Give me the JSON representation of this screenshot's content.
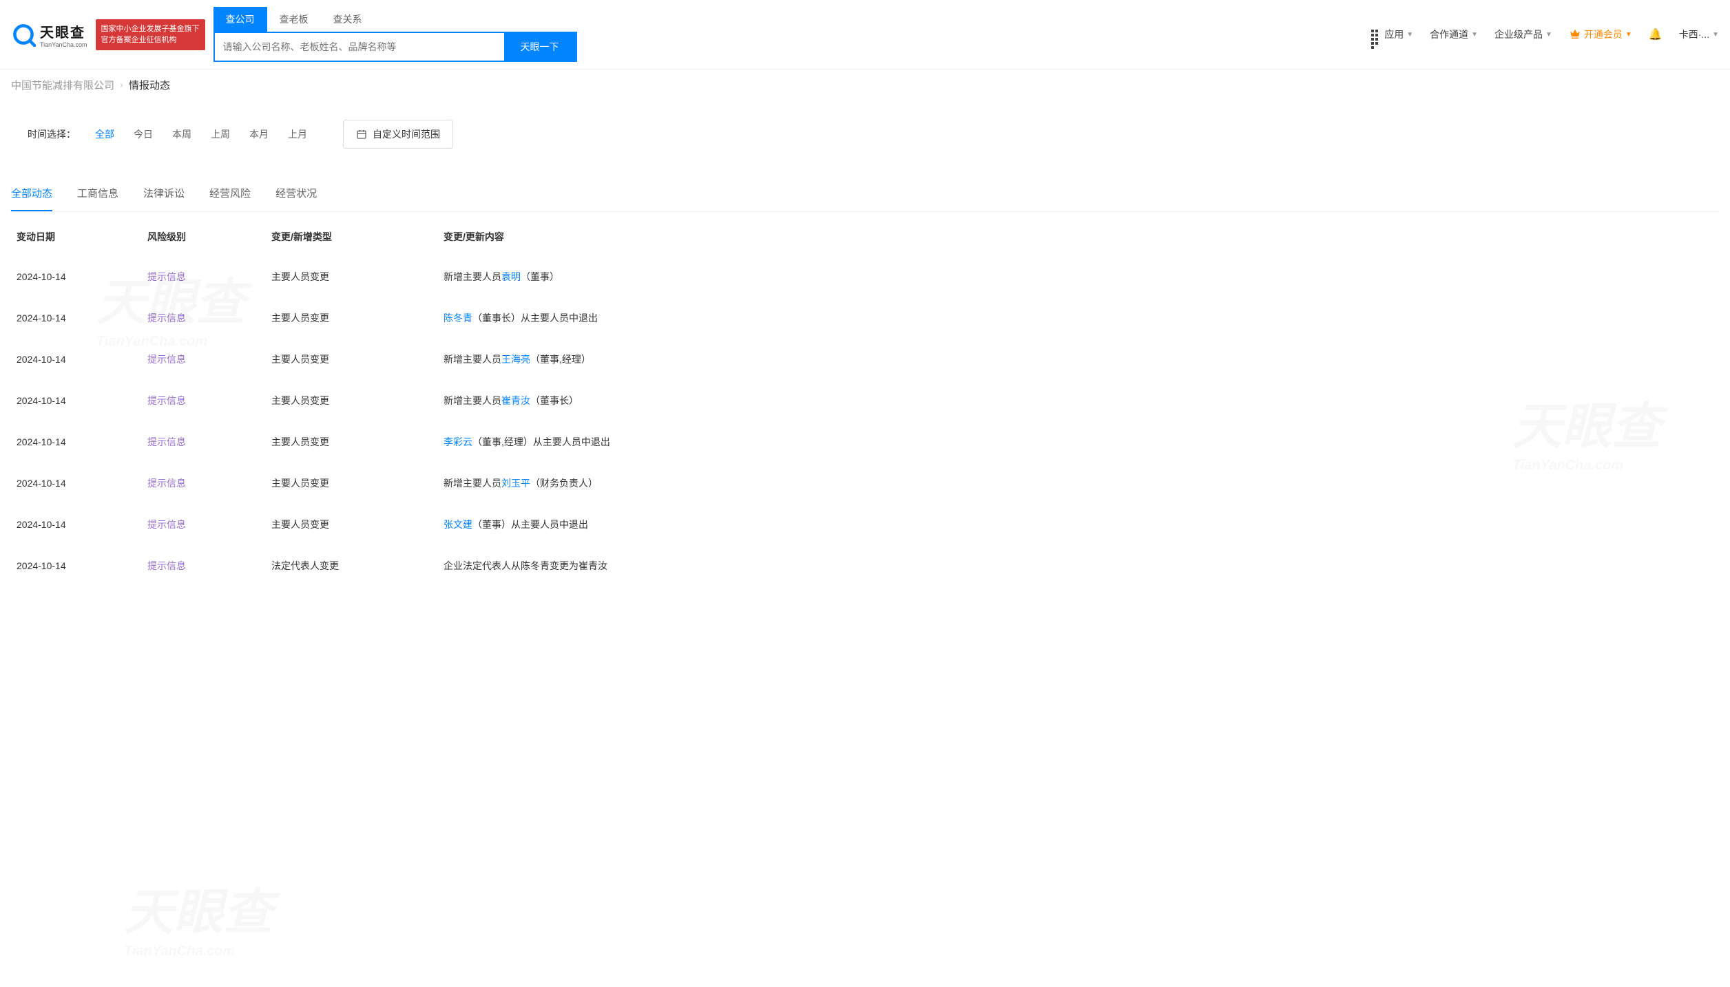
{
  "logo": {
    "cn": "天眼查",
    "en": "TianYanCha.com"
  },
  "badge": {
    "line1": "国家中小企业发展子基金旗下",
    "line2": "官方备案企业征信机构"
  },
  "search": {
    "tabs": [
      "查公司",
      "查老板",
      "查关系"
    ],
    "active_tab": 0,
    "placeholder": "请输入公司名称、老板姓名、品牌名称等",
    "button": "天眼一下"
  },
  "nav": {
    "app": "应用",
    "coop": "合作通道",
    "enterprise": "企业级产品",
    "vip": "开通会员",
    "user": "卡西·..."
  },
  "breadcrumb": {
    "company": "中国节能减排有限公司",
    "page": "情报动态"
  },
  "filter": {
    "label": "时间选择：",
    "options": [
      "全部",
      "今日",
      "本周",
      "上周",
      "本月",
      "上月"
    ],
    "active": 0,
    "custom": "自定义时间范围"
  },
  "tabs": {
    "items": [
      "全部动态",
      "工商信息",
      "法律诉讼",
      "经营风险",
      "经营状况"
    ],
    "active": 0
  },
  "table": {
    "headers": [
      "变动日期",
      "风险级别",
      "变更/新增类型",
      "变更/更新内容"
    ],
    "rows": [
      {
        "date": "2024-10-14",
        "risk": "提示信息",
        "type": "主要人员变更",
        "content": [
          {
            "text": "新增主要人员"
          },
          {
            "text": "袁明",
            "link": true
          },
          {
            "text": "（董事）"
          }
        ]
      },
      {
        "date": "2024-10-14",
        "risk": "提示信息",
        "type": "主要人员变更",
        "content": [
          {
            "text": "陈冬青",
            "link": true
          },
          {
            "text": "（董事长）从主要人员中退出"
          }
        ]
      },
      {
        "date": "2024-10-14",
        "risk": "提示信息",
        "type": "主要人员变更",
        "content": [
          {
            "text": "新增主要人员"
          },
          {
            "text": "王海亮",
            "link": true
          },
          {
            "text": "（董事,经理）"
          }
        ]
      },
      {
        "date": "2024-10-14",
        "risk": "提示信息",
        "type": "主要人员变更",
        "content": [
          {
            "text": "新增主要人员"
          },
          {
            "text": "崔青汝",
            "link": true
          },
          {
            "text": "（董事长）"
          }
        ]
      },
      {
        "date": "2024-10-14",
        "risk": "提示信息",
        "type": "主要人员变更",
        "content": [
          {
            "text": "李彩云",
            "link": true
          },
          {
            "text": "（董事,经理）从主要人员中退出"
          }
        ]
      },
      {
        "date": "2024-10-14",
        "risk": "提示信息",
        "type": "主要人员变更",
        "content": [
          {
            "text": "新增主要人员"
          },
          {
            "text": "刘玉平",
            "link": true
          },
          {
            "text": "（财务负责人）"
          }
        ]
      },
      {
        "date": "2024-10-14",
        "risk": "提示信息",
        "type": "主要人员变更",
        "content": [
          {
            "text": "张文建",
            "link": true
          },
          {
            "text": "（董事）从主要人员中退出"
          }
        ]
      },
      {
        "date": "2024-10-14",
        "risk": "提示信息",
        "type": "法定代表人变更",
        "content": [
          {
            "text": "企业法定代表人从陈冬青变更为崔青汝"
          }
        ]
      }
    ]
  }
}
